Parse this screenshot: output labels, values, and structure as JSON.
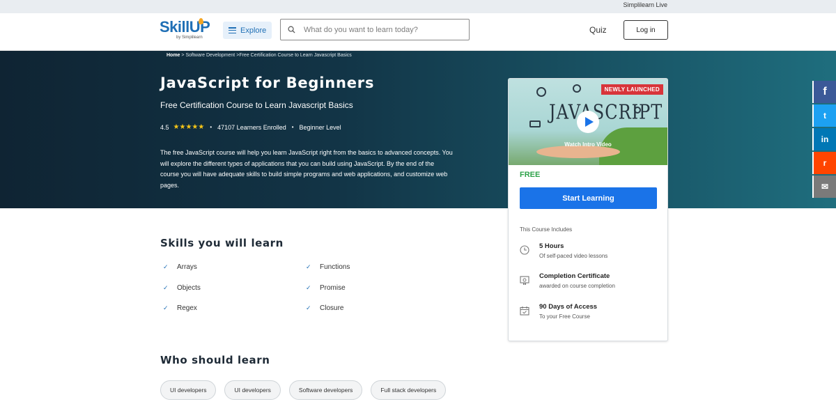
{
  "topbar": {
    "link": "Simplilearn Live"
  },
  "header": {
    "logo_text": "SkillUP",
    "logo_sub": "by Simplilearn",
    "explore_label": "Explore",
    "search_placeholder": "What do you want to learn today?",
    "quiz_label": "Quiz",
    "login_label": "Log in"
  },
  "breadcrumb": {
    "home": "Home",
    "sep1": " > ",
    "cat": "Software Development",
    "sep2": " >",
    "current": "Free Certification Course to Learn Javascript Basics"
  },
  "hero": {
    "title": "JavaScript for Beginners",
    "subtitle": "Free Certification Course to Learn Javascript Basics",
    "rating": "4.5",
    "stars": "★★★★★",
    "learners": "47107 Learners Enrolled",
    "level": "Beginner Level",
    "description": "The free JavaScript course will help you learn JavaScript right from the basics to advanced concepts. You will explore the different types of applications that you can build using JavaScript. By the end of the course you will have adequate skills to build simple programs and web applications, and customize web pages."
  },
  "card": {
    "badge": "NEWLY LAUNCHED",
    "thumb_word": "JAVASCRIPT",
    "watch_label": "Watch Intro Video",
    "price": "FREE",
    "cta": "Start Learning",
    "includes_title": "This Course Includes",
    "includes": [
      {
        "title": "5 Hours",
        "sub": "Of self-paced video lessons",
        "icon": "clock-icon"
      },
      {
        "title": "Completion Certificate",
        "sub": "awarded on course completion",
        "icon": "certificate-icon"
      },
      {
        "title": "90 Days of Access",
        "sub": "To your Free Course",
        "icon": "calendar-icon"
      }
    ]
  },
  "social": [
    "f",
    "t",
    "in",
    "r",
    "✉"
  ],
  "skills": {
    "title": "Skills you will learn",
    "left": [
      "Arrays",
      "Objects",
      "Regex"
    ],
    "right": [
      "Functions",
      "Promise",
      "Closure"
    ]
  },
  "who": {
    "title": "Who should learn",
    "tags": [
      "UI developers",
      "UI developers",
      "Software developers",
      "Full stack developers"
    ]
  }
}
